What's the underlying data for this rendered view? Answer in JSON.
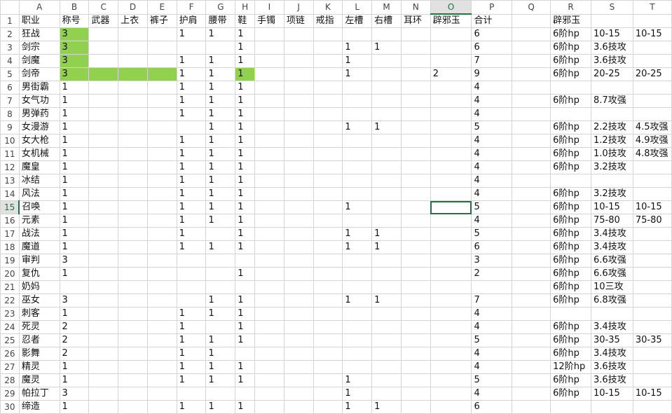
{
  "columns": [
    "A",
    "B",
    "C",
    "D",
    "E",
    "F",
    "G",
    "H",
    "I",
    "J",
    "K",
    "L",
    "M",
    "N",
    "O",
    "P",
    "Q",
    "R",
    "S",
    "T"
  ],
  "selected_column": "O",
  "selected_row": 15,
  "rows": [
    {
      "n": 1,
      "cells": [
        "职业",
        "称号",
        "武器",
        "上衣",
        "裤子",
        "护肩",
        "腰带",
        "鞋",
        "手镯",
        "项链",
        "戒指",
        "左槽",
        "右槽",
        "耳环",
        "辟邪玉",
        "合计",
        "",
        "辟邪玉",
        "",
        ""
      ]
    },
    {
      "n": 2,
      "cells": [
        "狂战",
        "3",
        "",
        "",
        "",
        "1",
        "1",
        "1",
        "",
        "",
        "",
        "",
        "",
        "",
        "",
        "6",
        "",
        "6阶hp",
        "10-15",
        "10-15"
      ]
    },
    {
      "n": 3,
      "cells": [
        "剑宗",
        "3",
        "",
        "",
        "",
        "",
        "",
        "1",
        "",
        "",
        "",
        "1",
        "1",
        "",
        "",
        "6",
        "",
        "6阶hp",
        "3.6技攻",
        ""
      ]
    },
    {
      "n": 4,
      "cells": [
        "剑魔",
        "3",
        "",
        "",
        "",
        "1",
        "1",
        "1",
        "",
        "",
        "",
        "1",
        "",
        "",
        "",
        "7",
        "",
        "6阶hp",
        "3.6技攻",
        ""
      ]
    },
    {
      "n": 5,
      "cells": [
        "剑帝",
        "3",
        "",
        "",
        "",
        "1",
        "1",
        "1",
        "",
        "",
        "",
        "1",
        "",
        "",
        "2",
        "9",
        "",
        "6阶hp",
        "20-25",
        "20-25"
      ]
    },
    {
      "n": 6,
      "cells": [
        "男街霸",
        "1",
        "",
        "",
        "",
        "1",
        "1",
        "1",
        "",
        "",
        "",
        "",
        "",
        "",
        "",
        "4",
        "",
        "",
        "",
        ""
      ]
    },
    {
      "n": 7,
      "cells": [
        "女气功",
        "1",
        "",
        "",
        "",
        "1",
        "1",
        "1",
        "",
        "",
        "",
        "",
        "",
        "",
        "",
        "4",
        "",
        "6阶hp",
        "8.7攻强",
        ""
      ]
    },
    {
      "n": 8,
      "cells": [
        "男弹药",
        "1",
        "",
        "",
        "",
        "1",
        "1",
        "1",
        "",
        "",
        "",
        "",
        "",
        "",
        "",
        "4",
        "",
        "",
        "",
        ""
      ]
    },
    {
      "n": 9,
      "cells": [
        "女漫游",
        "1",
        "",
        "",
        "",
        "",
        "1",
        "1",
        "",
        "",
        "",
        "1",
        "1",
        "",
        "",
        "5",
        "",
        "6阶hp",
        "2.2技攻",
        "4.5攻强"
      ]
    },
    {
      "n": 10,
      "cells": [
        "女大枪",
        "1",
        "",
        "",
        "",
        "1",
        "1",
        "1",
        "",
        "",
        "",
        "",
        "",
        "",
        "",
        "4",
        "",
        "6阶hp",
        "1.2技攻",
        "4.9攻强"
      ]
    },
    {
      "n": 11,
      "cells": [
        "女机械",
        "1",
        "",
        "",
        "",
        "1",
        "1",
        "1",
        "",
        "",
        "",
        "",
        "",
        "",
        "",
        "4",
        "",
        "6阶hp",
        "1.0技攻",
        "4.8攻强"
      ]
    },
    {
      "n": 12,
      "cells": [
        "魔皇",
        "1",
        "",
        "",
        "",
        "1",
        "1",
        "1",
        "",
        "",
        "",
        "",
        "",
        "",
        "",
        "4",
        "",
        "6阶hp",
        "3.2技攻",
        ""
      ]
    },
    {
      "n": 13,
      "cells": [
        "冰结",
        "1",
        "",
        "",
        "",
        "1",
        "1",
        "1",
        "",
        "",
        "",
        "",
        "",
        "",
        "",
        "4",
        "",
        "",
        "",
        ""
      ]
    },
    {
      "n": 14,
      "cells": [
        "风法",
        "1",
        "",
        "",
        "",
        "1",
        "1",
        "1",
        "",
        "",
        "",
        "",
        "",
        "",
        "",
        "4",
        "",
        "6阶hp",
        "3.2技攻",
        ""
      ]
    },
    {
      "n": 15,
      "cells": [
        "召唤",
        "1",
        "",
        "",
        "",
        "1",
        "1",
        "1",
        "",
        "",
        "",
        "1",
        "",
        "",
        "",
        "5",
        "",
        "6阶hp",
        "10-15",
        "10-15"
      ]
    },
    {
      "n": 16,
      "cells": [
        "元素",
        "1",
        "",
        "",
        "",
        "1",
        "1",
        "1",
        "",
        "",
        "",
        "",
        "",
        "",
        "",
        "4",
        "",
        "6阶hp",
        "75-80",
        "75-80"
      ]
    },
    {
      "n": 17,
      "cells": [
        "战法",
        "1",
        "",
        "",
        "",
        "1",
        "",
        "1",
        "",
        "",
        "",
        "1",
        "1",
        "",
        "",
        "5",
        "",
        "6阶hp",
        "3.4技攻",
        ""
      ]
    },
    {
      "n": 18,
      "cells": [
        "魔道",
        "1",
        "",
        "",
        "",
        "1",
        "1",
        "1",
        "",
        "",
        "",
        "1",
        "1",
        "",
        "",
        "6",
        "",
        "6阶hp",
        "3.4技攻",
        ""
      ]
    },
    {
      "n": 19,
      "cells": [
        "审判",
        "3",
        "",
        "",
        "",
        "",
        "",
        "",
        "",
        "",
        "",
        "",
        "",
        "",
        "",
        "3",
        "",
        "6阶hp",
        "6.6攻强",
        ""
      ]
    },
    {
      "n": 20,
      "cells": [
        "复仇",
        "1",
        "",
        "",
        "",
        "",
        "",
        "1",
        "",
        "",
        "",
        "",
        "",
        "",
        "",
        "2",
        "",
        "6阶hp",
        "6.6攻强",
        ""
      ]
    },
    {
      "n": 21,
      "cells": [
        "奶妈",
        "",
        "",
        "",
        "",
        "",
        "",
        "",
        "",
        "",
        "",
        "",
        "",
        "",
        "",
        "",
        "",
        "6阶hp",
        "10三攻",
        ""
      ]
    },
    {
      "n": 22,
      "cells": [
        "巫女",
        "3",
        "",
        "",
        "",
        "",
        "1",
        "1",
        "",
        "",
        "",
        "1",
        "1",
        "",
        "",
        "7",
        "",
        "6阶hp",
        "6.8攻强",
        ""
      ]
    },
    {
      "n": 23,
      "cells": [
        "刺客",
        "1",
        "",
        "",
        "",
        "1",
        "1",
        "1",
        "",
        "",
        "",
        "",
        "",
        "",
        "",
        "4",
        "",
        "",
        "",
        ""
      ]
    },
    {
      "n": 24,
      "cells": [
        "死灵",
        "2",
        "",
        "",
        "",
        "1",
        "",
        "1",
        "",
        "",
        "",
        "",
        "",
        "",
        "",
        "4",
        "",
        "6阶hp",
        "3.4技攻",
        ""
      ]
    },
    {
      "n": 25,
      "cells": [
        "忍者",
        "2",
        "",
        "",
        "",
        "1",
        "1",
        "1",
        "",
        "",
        "",
        "",
        "",
        "",
        "",
        "5",
        "",
        "6阶hp",
        "30-35",
        "30-35"
      ]
    },
    {
      "n": 26,
      "cells": [
        "影舞",
        "2",
        "",
        "",
        "",
        "1",
        "1",
        "",
        "",
        "",
        "",
        "",
        "",
        "",
        "",
        "4",
        "",
        "6阶hp",
        "3.4技攻",
        ""
      ]
    },
    {
      "n": 27,
      "cells": [
        "精灵",
        "1",
        "",
        "",
        "",
        "1",
        "1",
        "1",
        "",
        "",
        "",
        "",
        "",
        "",
        "",
        "4",
        "",
        "12阶hp",
        "3.6技攻",
        ""
      ]
    },
    {
      "n": 28,
      "cells": [
        "魔灵",
        "1",
        "",
        "",
        "",
        "1",
        "1",
        "1",
        "",
        "",
        "",
        "1",
        "",
        "",
        "",
        "5",
        "",
        "6阶hp",
        "3.6技攻",
        ""
      ]
    },
    {
      "n": 29,
      "cells": [
        "帕拉丁",
        "3",
        "",
        "",
        "",
        "",
        "",
        "",
        "",
        "",
        "",
        "1",
        "",
        "",
        "",
        "4",
        "",
        "6阶hp",
        "10-15",
        "10-15"
      ]
    },
    {
      "n": 30,
      "cells": [
        "缔造",
        "1",
        "",
        "",
        "",
        "1",
        "1",
        "1",
        "",
        "",
        "",
        "1",
        "1",
        "",
        "",
        "6",
        "",
        "",
        "",
        ""
      ]
    }
  ],
  "highlights": [
    {
      "row": 2,
      "cols": [
        "B"
      ]
    },
    {
      "row": 3,
      "cols": [
        "B"
      ]
    },
    {
      "row": 4,
      "cols": [
        "B"
      ]
    },
    {
      "row": 5,
      "cols": [
        "B",
        "C",
        "D",
        "E",
        "H"
      ]
    }
  ],
  "highlight_color": "#92d050",
  "selection_color": "#217346"
}
